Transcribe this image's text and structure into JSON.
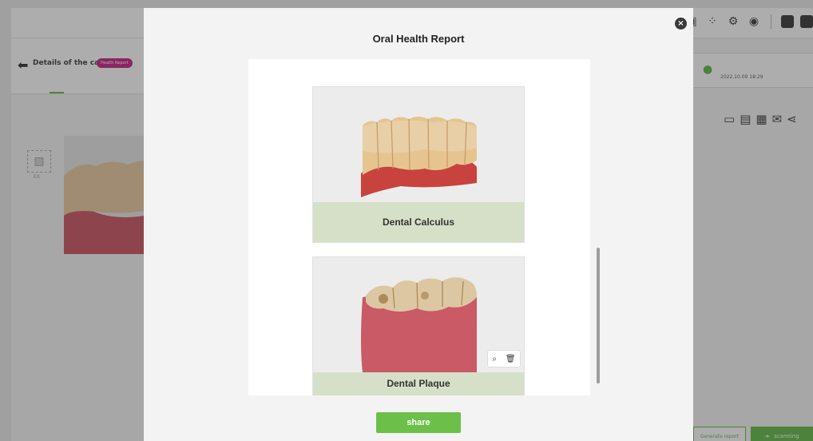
{
  "app": {
    "case_title": "Details of the case",
    "report_badge": "Health Report",
    "thumb_label": "EX",
    "patient_date": "2022.10.09 18:29",
    "generate_report_label": "Generate report",
    "scanning_label": "scanning"
  },
  "modal": {
    "title": "Oral Health Report",
    "close_glyph": "×",
    "share_label": "share",
    "cards": [
      {
        "label": "Dental Calculus"
      },
      {
        "label": "Dental Plaque"
      }
    ]
  },
  "icons": {
    "back": "arrow-left-icon",
    "user": "user-icon",
    "zoom": "zoom-icon",
    "delete": "trash-icon"
  },
  "colors": {
    "accent": "#58b53b",
    "share": "#6cc04a",
    "badge": "#c2187d",
    "card_label_bg": "#d6e0c8"
  }
}
